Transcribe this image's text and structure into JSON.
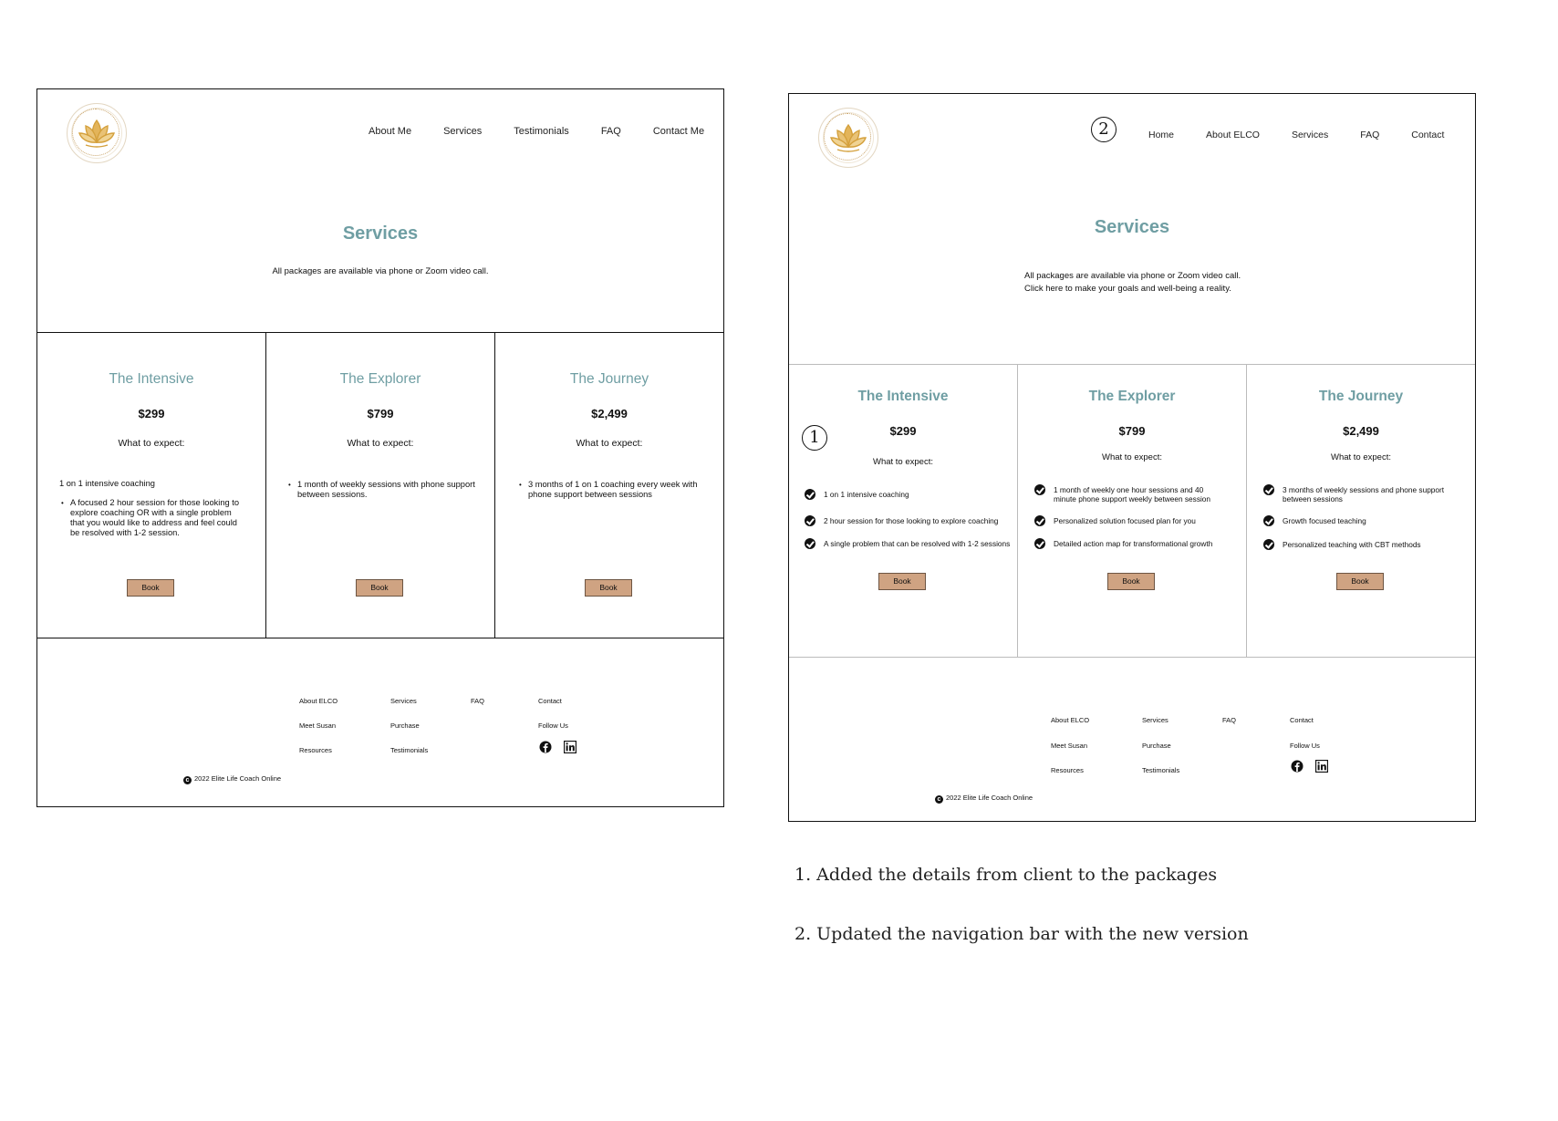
{
  "v1": {
    "nav": [
      "About Me",
      "Services",
      "Testimonials",
      "FAQ",
      "Contact Me"
    ],
    "title": "Services",
    "subtitle": "All packages are available via phone or Zoom video call.",
    "cards": [
      {
        "name": "The Intensive",
        "price": "$299",
        "expect": "What to expect:",
        "plain": "1 on 1 intensive coaching",
        "bullets": [
          "A focused 2 hour session for those looking to explore coaching OR with a single problem that you would like to address and feel could be resolved with 1-2 session."
        ],
        "book": "Book"
      },
      {
        "name": "The Explorer",
        "price": "$799",
        "expect": "What to expect:",
        "bullets": [
          "1 month of weekly sessions with phone support between sessions."
        ],
        "book": "Book"
      },
      {
        "name": "The Journey",
        "price": "$2,499",
        "expect": "What to expect:",
        "bullets": [
          "3 months of 1 on 1 coaching every week with phone support between sessions"
        ],
        "book": "Book"
      }
    ]
  },
  "v2": {
    "nav": [
      "Home",
      "About ELCO",
      "Services",
      "FAQ",
      "Contact"
    ],
    "title": "Services",
    "subtitle_line1": "All packages are available via phone or Zoom video call.",
    "subtitle_line2": "Click here to make your goals and well-being a reality.",
    "cards": [
      {
        "name": "The Intensive",
        "price": "$299",
        "expect": "What to expect:",
        "features": [
          "1 on 1 intensive coaching",
          "2 hour session for those looking to explore coaching",
          "A single problem that can be resolved with 1-2 sessions"
        ],
        "book": "Book"
      },
      {
        "name": "The Explorer",
        "price": "$799",
        "expect": "What to expect:",
        "features": [
          "1 month of weekly one hour sessions and 40 minute phone support weekly between session",
          "Personalized solution focused plan for you",
          "Detailed action map for transformational growth"
        ],
        "book": "Book"
      },
      {
        "name": "The Journey",
        "price": "$2,499",
        "expect": "What to expect:",
        "features": [
          "3 months of weekly sessions and phone support between sessions",
          "Growth focused teaching",
          "Personalized teaching with CBT methods"
        ],
        "book": "Book"
      }
    ]
  },
  "footer": {
    "links": [
      "About ELCO",
      "Services",
      "FAQ",
      "Contact",
      "Meet Susan",
      "Purchase",
      "Follow Us",
      "Resources",
      "Testimonials"
    ],
    "copyright": "2022 Elite Life Coach Online",
    "social_icons": [
      "facebook-icon",
      "linkedin-icon"
    ]
  },
  "annotations": {
    "marker1": "1",
    "marker2": "2",
    "notes": [
      "1. Added the details from client to the packages",
      "2. Updated the navigation bar with the new version"
    ]
  },
  "colors": {
    "accent_teal": "#6f9ea3",
    "button_tan": "#cfa382",
    "logo_gold": "#d4a03c"
  }
}
